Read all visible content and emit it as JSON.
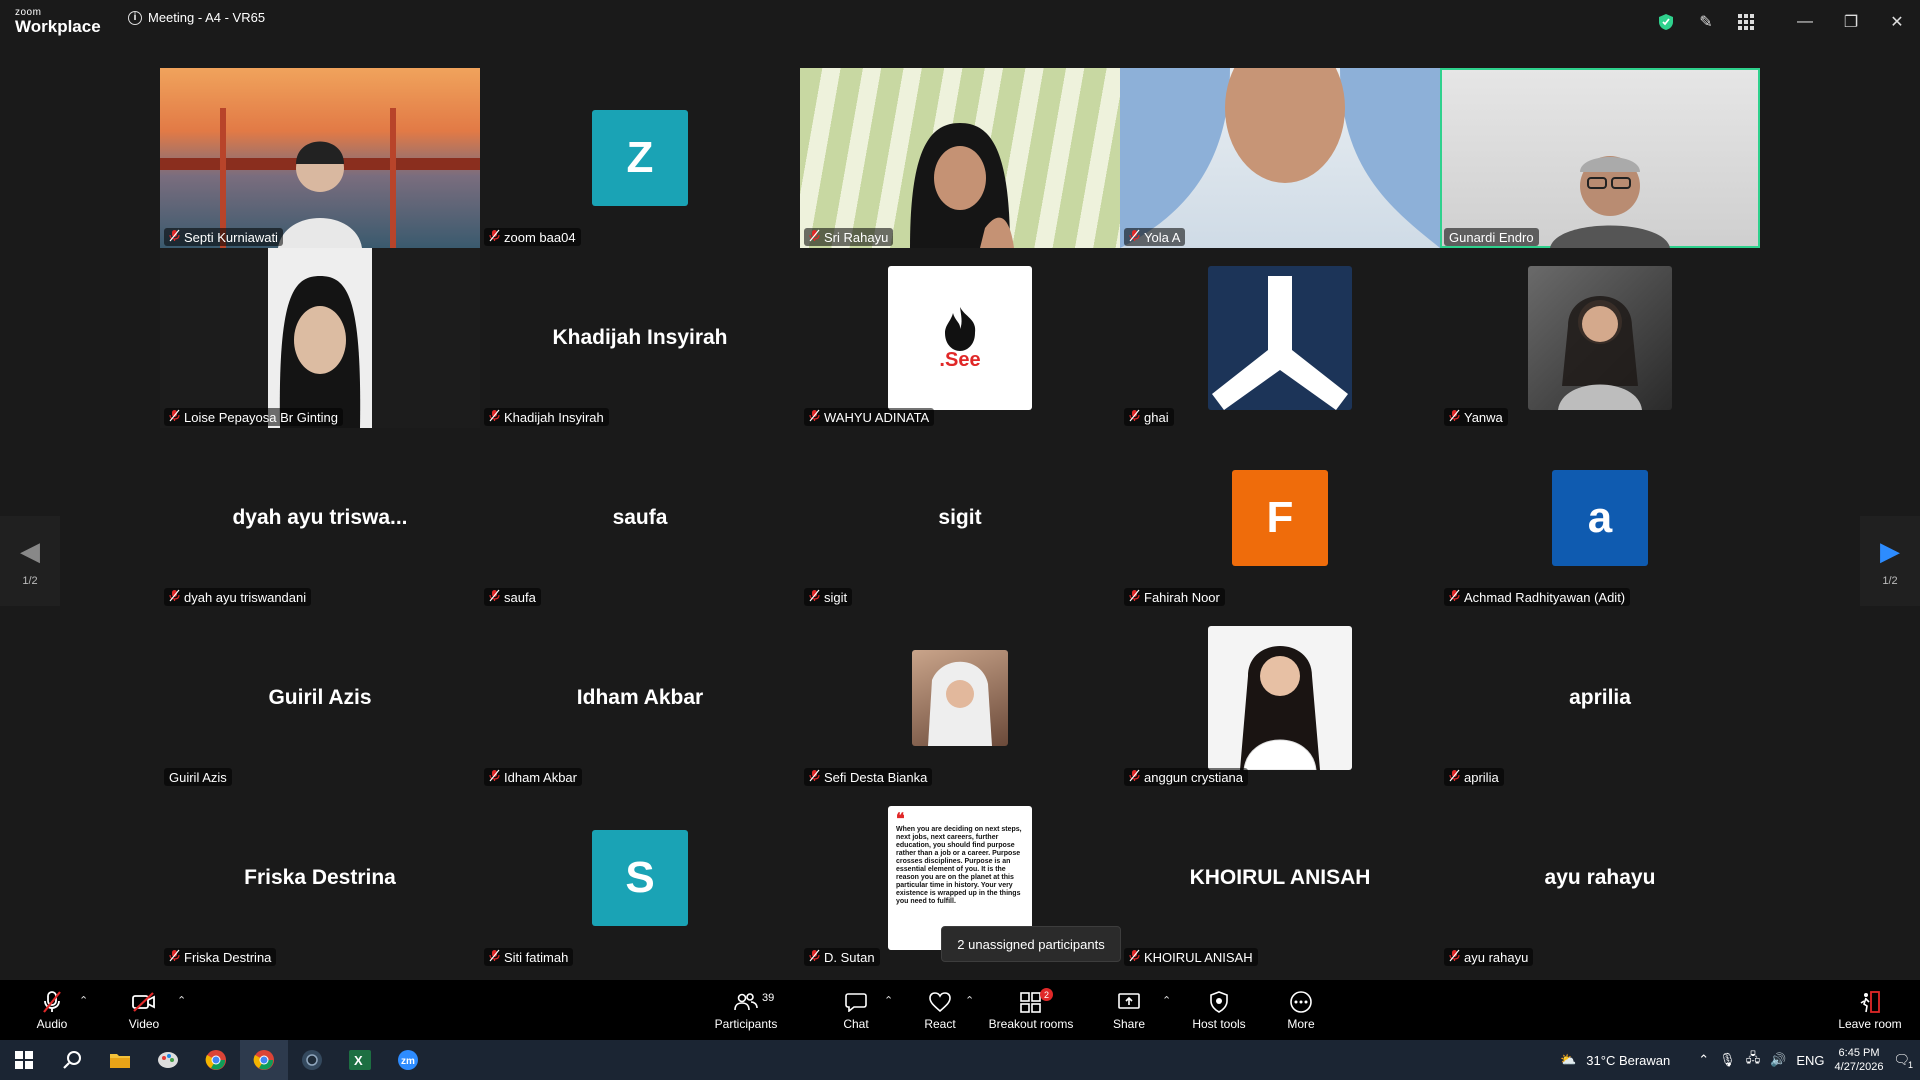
{
  "app": {
    "logo_line1": "zoom",
    "logo_line2": "Workplace",
    "meeting_title": "Meeting - A4 - VR65"
  },
  "gallery": {
    "page_indicator": "1/2",
    "tiles": [
      {
        "name": "Septi Kurniawati",
        "kind": "video",
        "muted": true
      },
      {
        "name": "zoom baa04",
        "kind": "letter",
        "letter": "Z",
        "color": "#1aa3b5",
        "muted": true
      },
      {
        "name": "Sri Rahayu",
        "kind": "video",
        "muted": true
      },
      {
        "name": "Yola A",
        "kind": "video",
        "muted": true
      },
      {
        "name": "Gunardi Endro",
        "kind": "video",
        "muted": false,
        "active": true
      },
      {
        "name": "Loise Pepayosa Br Ginting",
        "kind": "video",
        "muted": true
      },
      {
        "name": "Khadijah Insyirah",
        "kind": "name",
        "display": "Khadijah Insyirah",
        "muted": true
      },
      {
        "name": "WAHYU ADINATA",
        "kind": "picture",
        "picture": "fire-logo",
        "muted": true
      },
      {
        "name": "ghai",
        "kind": "picture",
        "picture": "triangle-logo",
        "muted": true
      },
      {
        "name": "Yanwa",
        "kind": "picture",
        "picture": "profile-photo",
        "muted": true
      },
      {
        "name": "dyah ayu triswandani",
        "kind": "name",
        "display": "dyah ayu triswa...",
        "muted": true
      },
      {
        "name": "saufa",
        "kind": "name",
        "display": "saufa",
        "muted": true
      },
      {
        "name": "sigit",
        "kind": "name",
        "display": "sigit",
        "muted": true
      },
      {
        "name": "Fahirah Noor",
        "kind": "letter",
        "letter": "F",
        "color": "#ef6c0b",
        "muted": true
      },
      {
        "name": "Achmad Radhityawan (Adit)",
        "kind": "letter",
        "letter": "a",
        "color": "#0f5bb0",
        "muted": true
      },
      {
        "name": "Guiril Azis",
        "kind": "name",
        "display": "Guiril Azis",
        "muted": false
      },
      {
        "name": "Idham Akbar",
        "kind": "name",
        "display": "Idham Akbar",
        "muted": true
      },
      {
        "name": "Sefi Desta Bianka",
        "kind": "picture",
        "picture": "small-photo",
        "muted": true
      },
      {
        "name": "anggun crystiana",
        "kind": "picture",
        "picture": "portrait-photo",
        "muted": true
      },
      {
        "name": "aprilia",
        "kind": "name",
        "display": "aprilia",
        "muted": true
      },
      {
        "name": "Friska Destrina",
        "kind": "name",
        "display": "Friska Destrina",
        "muted": true
      },
      {
        "name": "Siti fatimah",
        "kind": "letter",
        "letter": "S",
        "color": "#1aa3b5",
        "muted": true
      },
      {
        "name": "D. Sutan",
        "kind": "picture",
        "picture": "quote-card",
        "muted": true
      },
      {
        "name": "KHOIRUL ANISAH",
        "kind": "name",
        "display": "KHOIRUL ANISAH",
        "muted": true
      },
      {
        "name": "ayu rahayu",
        "kind": "name",
        "display": "ayu rahayu",
        "muted": true
      }
    ],
    "quote_text": "When you are deciding on next steps, next jobs, next careers, further education, you should find purpose rather than a job or a career. Purpose crosses disciplines. Purpose is an essential element of you. It is the reason you are on the planet at this particular time in history. Your very existence is wrapped up in the things you need to fulfill.",
    "fire_logo_text": ".See"
  },
  "tooltip": "2 unassigned participants",
  "toolbar": {
    "audio": "Audio",
    "video": "Video",
    "participants": "Participants",
    "participants_count": "39",
    "chat": "Chat",
    "react": "React",
    "breakout": "Breakout rooms",
    "breakout_badge": "2",
    "share": "Share",
    "host_tools": "Host tools",
    "more": "More",
    "leave": "Leave room"
  },
  "taskbar": {
    "weather": "31°C  Berawan",
    "lang": "ENG",
    "time": "6:45 PM",
    "date": "4/27/2026",
    "notif_count": "1"
  },
  "colors": {
    "active_border": "#2fd18d",
    "muted_mic": "#e02828",
    "shield": "#2fd18d"
  }
}
